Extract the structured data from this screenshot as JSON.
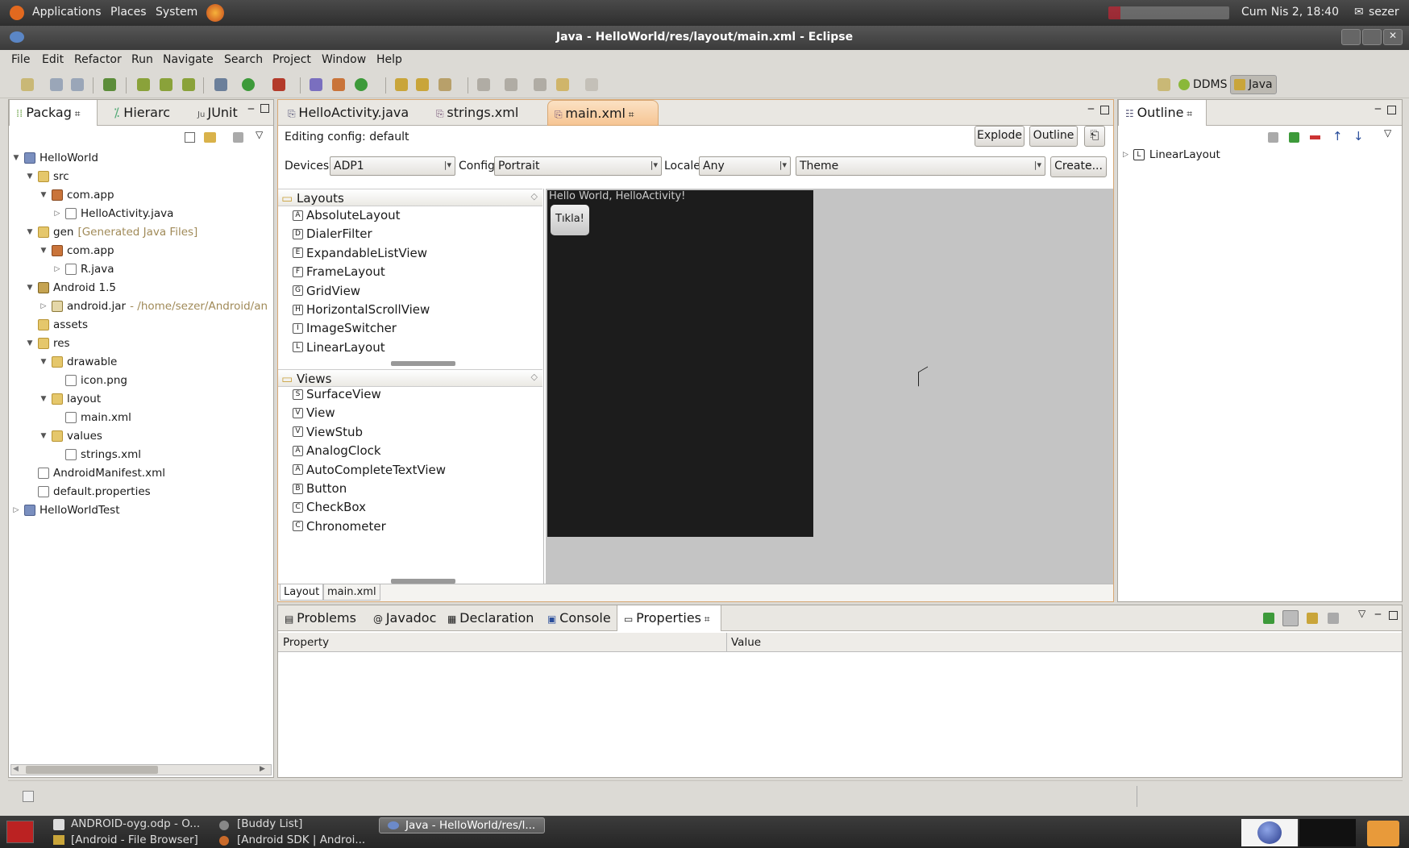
{
  "top_panel": {
    "applications": "Applications",
    "places": "Places",
    "system": "System",
    "datetime": "Cum Nis  2, 18:40",
    "user": "sezer"
  },
  "window": {
    "title": "Java - HelloWorld/res/layout/main.xml - Eclipse"
  },
  "menu": [
    "File",
    "Edit",
    "Refactor",
    "Run",
    "Navigate",
    "Search",
    "Project",
    "Window",
    "Help"
  ],
  "perspectives": {
    "ddms": "DDMS",
    "java": "Java"
  },
  "left_panel": {
    "tabs": [
      "Packag",
      "Hierarc",
      "JUnit"
    ],
    "tree": [
      {
        "label": "HelloWorld",
        "extra": "",
        "indent": 0,
        "twisty": "▼",
        "icon": "proj"
      },
      {
        "label": "src",
        "extra": "",
        "indent": 1,
        "twisty": "▼",
        "icon": "fold"
      },
      {
        "label": "com.app",
        "extra": "",
        "indent": 2,
        "twisty": "▼",
        "icon": "pkg"
      },
      {
        "label": "HelloActivity.java",
        "extra": "",
        "indent": 3,
        "twisty": "▷",
        "icon": "file"
      },
      {
        "label": "gen",
        "extra": "[Generated Java Files]",
        "indent": 1,
        "twisty": "▼",
        "icon": "fold"
      },
      {
        "label": "com.app",
        "extra": "",
        "indent": 2,
        "twisty": "▼",
        "icon": "pkg"
      },
      {
        "label": "R.java",
        "extra": "",
        "indent": 3,
        "twisty": "▷",
        "icon": "file"
      },
      {
        "label": "Android 1.5",
        "extra": "",
        "indent": 1,
        "twisty": "▼",
        "icon": "lib"
      },
      {
        "label": "android.jar",
        "extra": "- /home/sezer/Android/an",
        "indent": 2,
        "twisty": "▷",
        "icon": "jar"
      },
      {
        "label": "assets",
        "extra": "",
        "indent": 1,
        "twisty": "",
        "icon": "fold"
      },
      {
        "label": "res",
        "extra": "",
        "indent": 1,
        "twisty": "▼",
        "icon": "fold"
      },
      {
        "label": "drawable",
        "extra": "",
        "indent": 2,
        "twisty": "▼",
        "icon": "fold"
      },
      {
        "label": "icon.png",
        "extra": "",
        "indent": 3,
        "twisty": "",
        "icon": "file"
      },
      {
        "label": "layout",
        "extra": "",
        "indent": 2,
        "twisty": "▼",
        "icon": "fold"
      },
      {
        "label": "main.xml",
        "extra": "",
        "indent": 3,
        "twisty": "",
        "icon": "file"
      },
      {
        "label": "values",
        "extra": "",
        "indent": 2,
        "twisty": "▼",
        "icon": "fold"
      },
      {
        "label": "strings.xml",
        "extra": "",
        "indent": 3,
        "twisty": "",
        "icon": "file"
      },
      {
        "label": "AndroidManifest.xml",
        "extra": "",
        "indent": 1,
        "twisty": "",
        "icon": "file"
      },
      {
        "label": "default.properties",
        "extra": "",
        "indent": 1,
        "twisty": "",
        "icon": "file"
      },
      {
        "label": "HelloWorldTest",
        "extra": "",
        "indent": 0,
        "twisty": "▷",
        "icon": "proj"
      }
    ]
  },
  "editor": {
    "tabs": [
      "HelloActivity.java",
      "strings.xml",
      "main.xml"
    ],
    "editing_config": "Editing config: default",
    "explode": "Explode",
    "outline": "Outline",
    "devices_label": "Devices",
    "devices_value": "ADP1",
    "config_label": "Config",
    "config_value": "Portrait",
    "locale_label": "Locale",
    "locale_value": "Any",
    "theme_value": "Theme",
    "create": "Create...",
    "layouts_header": "Layouts",
    "layouts": [
      "AbsoluteLayout",
      "DialerFilter",
      "ExpandableListView",
      "FrameLayout",
      "GridView",
      "HorizontalScrollView",
      "ImageSwitcher",
      "LinearLayout"
    ],
    "layout_icons": [
      "A",
      "D",
      "E",
      "F",
      "G",
      "H",
      "I",
      "L"
    ],
    "views_header": "Views",
    "views": [
      "SurfaceView",
      "View",
      "ViewStub",
      "AnalogClock",
      "AutoCompleteTextView",
      "Button",
      "CheckBox",
      "Chronometer"
    ],
    "view_icons": [
      "S",
      "V",
      "V",
      "A",
      "A",
      "B",
      "C",
      "C"
    ],
    "preview_text": "Hello World, HelloActivity!",
    "preview_button": "Tıkla!",
    "bottom_tabs": [
      "Layout",
      "main.xml"
    ]
  },
  "outline_panel": {
    "tab": "Outline",
    "root": "LinearLayout"
  },
  "bottom_panel": {
    "tabs": [
      "Problems",
      "Javadoc",
      "Declaration",
      "Console",
      "Properties"
    ],
    "col_property": "Property",
    "col_value": "Value"
  },
  "taskbar": {
    "items": [
      "ANDROID-oyg.odp - O...",
      "[Buddy List]",
      "Java - HelloWorld/res/l...",
      "[Android - File Browser]",
      "[Android SDK | Androi..."
    ]
  }
}
